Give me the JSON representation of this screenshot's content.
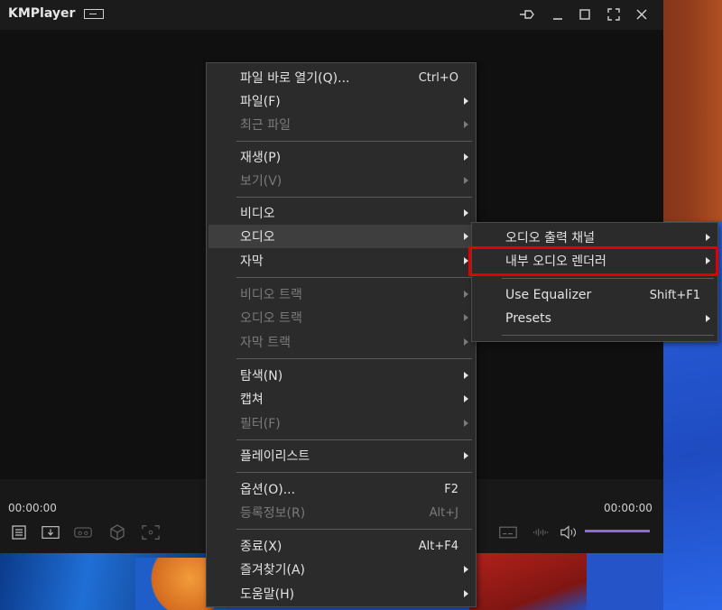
{
  "window": {
    "app_title": "KMPlayer",
    "title_icons": [
      "pin-icon",
      "minimize-icon",
      "maximize-icon",
      "fullscreen-icon",
      "close-icon"
    ]
  },
  "controls": {
    "time_current": "00:00:00",
    "time_total": "00:00:00",
    "left_icons": [
      "playlist-icon",
      "download-icon",
      "vr-icon",
      "3d-icon",
      "capture-icon"
    ],
    "right_icons": [
      "subtitle-icon",
      "equalizer-icon",
      "volume-icon"
    ],
    "volume_color": "#8a66e8"
  },
  "main_menu": {
    "items": [
      {
        "label": "파일 바로 열기(Q)...",
        "shortcut": "Ctrl+O",
        "submenu": false,
        "disabled": false
      },
      {
        "label": "파일(F)",
        "shortcut": "",
        "submenu": true,
        "disabled": false
      },
      {
        "label": "최근 파일",
        "shortcut": "",
        "submenu": true,
        "disabled": true
      },
      {
        "label": "재생(P)",
        "shortcut": "",
        "submenu": true,
        "disabled": false
      },
      {
        "label": "보기(V)",
        "shortcut": "",
        "submenu": true,
        "disabled": true
      },
      {
        "label": "비디오",
        "shortcut": "",
        "submenu": true,
        "disabled": false
      },
      {
        "label": "오디오",
        "shortcut": "",
        "submenu": true,
        "disabled": false,
        "active": true
      },
      {
        "label": "자막",
        "shortcut": "",
        "submenu": true,
        "disabled": false
      },
      {
        "label": "비디오 트랙",
        "shortcut": "",
        "submenu": true,
        "disabled": true
      },
      {
        "label": "오디오 트랙",
        "shortcut": "",
        "submenu": true,
        "disabled": true
      },
      {
        "label": "자막 트랙",
        "shortcut": "",
        "submenu": true,
        "disabled": true
      },
      {
        "label": "탐색(N)",
        "shortcut": "",
        "submenu": true,
        "disabled": false
      },
      {
        "label": "캡쳐",
        "shortcut": "",
        "submenu": true,
        "disabled": false
      },
      {
        "label": "필터(F)",
        "shortcut": "",
        "submenu": true,
        "disabled": true
      },
      {
        "label": "플레이리스트",
        "shortcut": "",
        "submenu": true,
        "disabled": false
      },
      {
        "label": "옵션(O)...",
        "shortcut": "F2",
        "submenu": false,
        "disabled": false
      },
      {
        "label": "등록정보(R)",
        "shortcut": "Alt+J",
        "submenu": false,
        "disabled": true
      },
      {
        "label": "종료(X)",
        "shortcut": "Alt+F4",
        "submenu": false,
        "disabled": false
      },
      {
        "label": "즐겨찾기(A)",
        "shortcut": "",
        "submenu": true,
        "disabled": false
      },
      {
        "label": "도움말(H)",
        "shortcut": "",
        "submenu": true,
        "disabled": false
      }
    ]
  },
  "audio_submenu": {
    "items": [
      {
        "label": "오디오 출력 채널",
        "shortcut": "",
        "submenu": true
      },
      {
        "label": "내부 오디오 렌더러",
        "shortcut": "",
        "submenu": true,
        "highlighted": true
      },
      {
        "label": "Use Equalizer",
        "shortcut": "Shift+F1",
        "submenu": false
      },
      {
        "label": "Presets",
        "shortcut": "",
        "submenu": true
      }
    ]
  },
  "highlight_color": "#e00000"
}
